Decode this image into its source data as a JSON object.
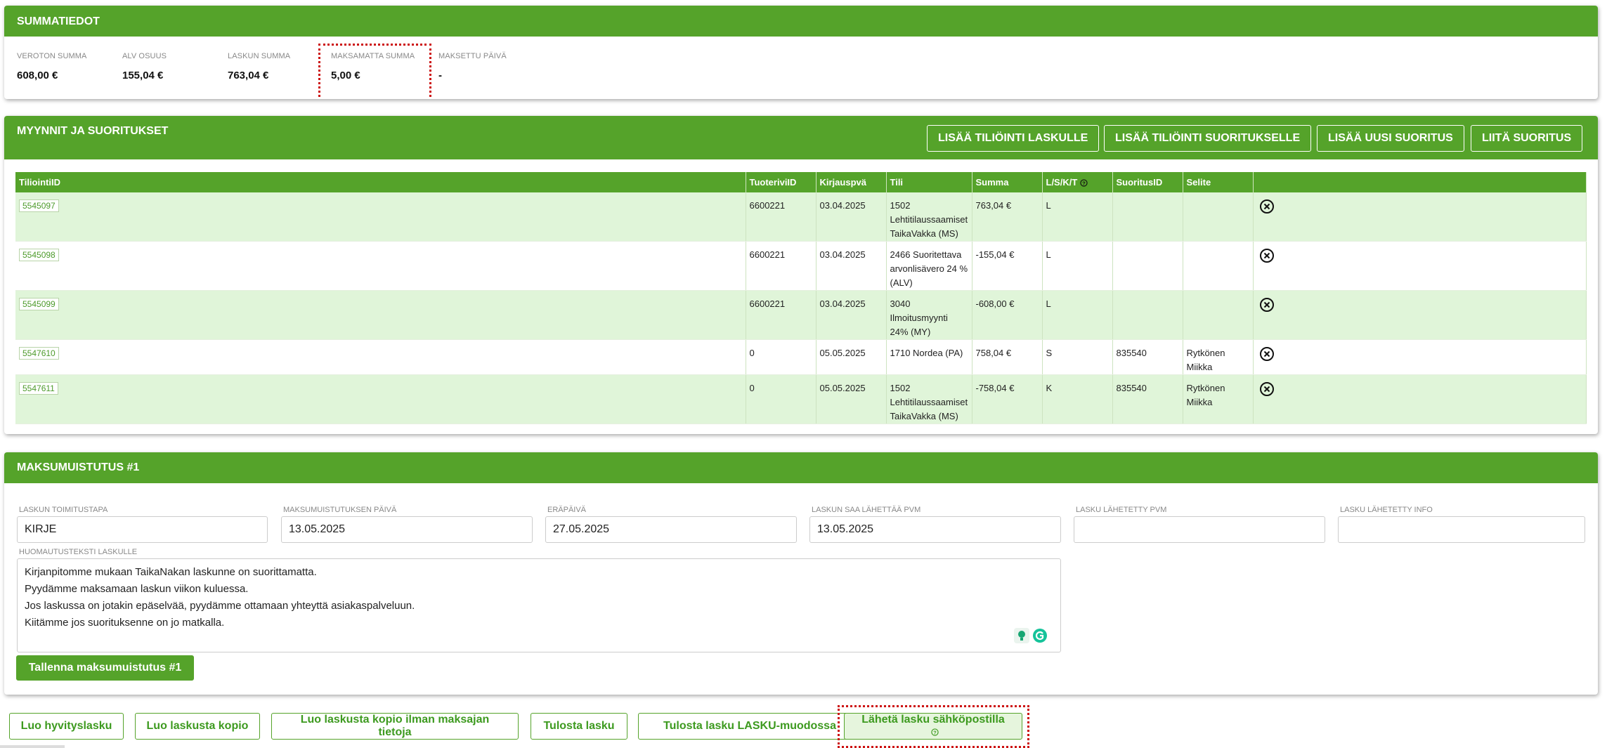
{
  "summary": {
    "title": "SUMMATIEDOT",
    "items": [
      {
        "label": "VEROTON SUMMA",
        "value": "608,00 €"
      },
      {
        "label": "ALV OSUUS",
        "value": "155,04 €"
      },
      {
        "label": "LASKUN SUMMA",
        "value": "763,04 €"
      },
      {
        "label": "MAKSAMATTA SUMMA",
        "value": "5,00 €"
      },
      {
        "label": "MAKSETTU PÄIVÄ",
        "value": "-"
      }
    ]
  },
  "sales": {
    "title": "MYYNNIT JA SUORITUKSET",
    "buttons": {
      "add_invoice_entry": "LISÄÄ TILIÖINTI LASKULLE",
      "add_payment_entry": "LISÄÄ TILIÖINTI SUORITUKSELLE",
      "add_new_payment": "LISÄÄ UUSI SUORITUS",
      "attach_payment": "LIITÄ SUORITUS"
    },
    "columns": [
      "TiliointiID",
      "TuoteriviID",
      "Kirjauspvä",
      "Tili",
      "Summa",
      "L/S/K/T",
      "SuoritusID",
      "Selite"
    ],
    "rows": [
      {
        "id": "5545097",
        "product_row": "6600221",
        "date": "03.04.2025",
        "account": [
          "1502",
          "Lehtitilaussaamiset",
          "TaikaVakka (MS)"
        ],
        "amount": "763,04 €",
        "type": "L",
        "payment_id": "",
        "description": [
          "",
          ""
        ]
      },
      {
        "id": "5545098",
        "product_row": "6600221",
        "date": "03.04.2025",
        "account": [
          "2466 Suoritettava",
          "arvonlisävero 24 %",
          "(ALV)"
        ],
        "amount": "-155,04 €",
        "type": "L",
        "payment_id": "",
        "description": [
          "",
          ""
        ]
      },
      {
        "id": "5545099",
        "product_row": "6600221",
        "date": "03.04.2025",
        "account": [
          "3040",
          "Ilmoitusmyynti",
          "24% (MY)"
        ],
        "amount": "-608,00 €",
        "type": "L",
        "payment_id": "",
        "description": [
          "",
          ""
        ]
      },
      {
        "id": "5547610",
        "product_row": "0",
        "date": "05.05.2025",
        "account": [
          "1710 Nordea (PA)",
          "",
          ""
        ],
        "amount": "758,04 €",
        "type": "S",
        "payment_id": "835540",
        "description": [
          "Rytkönen",
          "Miikka"
        ]
      },
      {
        "id": "5547611",
        "product_row": "0",
        "date": "05.05.2025",
        "account": [
          "1502",
          "Lehtitilaussaamiset",
          "TaikaVakka (MS)"
        ],
        "amount": "-758,04 €",
        "type": "K",
        "payment_id": "835540",
        "description": [
          "Rytkönen",
          "Miikka"
        ]
      }
    ]
  },
  "reminder": {
    "title": "MAKSUMUISTUTUS #1",
    "fields": {
      "delivery_method": {
        "label": "LASKUN TOIMITUSTAPA",
        "value": "KIRJE"
      },
      "reminder_date": {
        "label": "MAKSUMUISTUTUKSEN PÄIVÄ",
        "value": "13.05.2025"
      },
      "due_date": {
        "label": "ERÄPÄIVÄ",
        "value": "27.05.2025"
      },
      "send_allowed_date": {
        "label": "LASKUN SAA LÄHETTÄÄ PVM",
        "value": "13.05.2025"
      },
      "sent_date": {
        "label": "LASKU LÄHETETTY PVM",
        "value": ""
      },
      "sent_info": {
        "label": "LASKU LÄHETETTY INFO",
        "value": ""
      }
    },
    "note": {
      "label": "HUOMAUTUSTEKSTI LASKULLE",
      "lines": [
        "Kirjanpitomme mukaan TaikaNakan laskunne on suorittamatta.",
        "Pyydämme maksamaan laskun viikon kuluessa.",
        "Jos laskussa on jotakin epäselvää, pyydämme ottamaan yhteyttä asiakaspalveluun.",
        "Kiitämme jos suorituksenne on jo matkalla."
      ]
    },
    "save_label": "Tallenna maksumuistutus #1"
  },
  "actions": {
    "credit_invoice": "Luo hyvityslasku",
    "copy_invoice": "Luo laskusta kopio",
    "copy_without_payer": "Luo laskusta kopio ilman maksajan tietoja",
    "print_invoice": "Tulosta lasku",
    "print_lasku_format": "Tulosta lasku LASKU-muodossa",
    "send_email": "Lähetä lasku sähköpostilla"
  },
  "colors": {
    "accent": "#55a32a",
    "row_alt": "#e0f5d9",
    "highlight": "#cc1111"
  }
}
